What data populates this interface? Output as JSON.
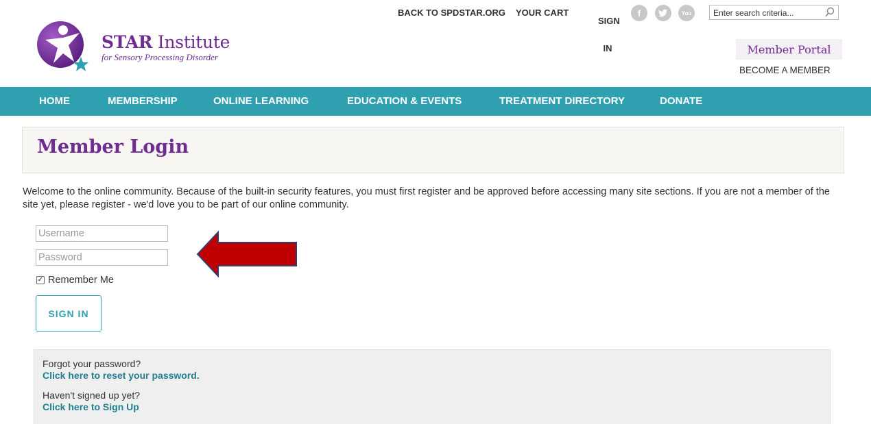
{
  "brand": {
    "name_bold": "STAR",
    "name_rest": "Institute",
    "tagline": "for Sensory Processing Disorder"
  },
  "toplinks": {
    "back": "BACK TO SPDSTAR.ORG",
    "cart": "YOUR CART",
    "signin": "SIGN IN"
  },
  "social": {
    "facebook": "f",
    "twitter": "t",
    "youtube": "You"
  },
  "search": {
    "placeholder": "Enter search criteria..."
  },
  "account": {
    "portal": "Member Portal",
    "become": "BECOME A MEMBER"
  },
  "nav": {
    "items": [
      "HOME",
      "MEMBERSHIP",
      "ONLINE LEARNING",
      "EDUCATION & EVENTS",
      "TREATMENT DIRECTORY",
      "DONATE"
    ]
  },
  "page": {
    "title": "Member Login",
    "intro": "Welcome to the online community. Because of the built-in security features, you must first register and be approved before accessing many site sections. If you are not a member of the site yet, please register - we'd love you to be part of our online community."
  },
  "form": {
    "username_placeholder": "Username",
    "password_placeholder": "Password",
    "remember_label": "Remember Me",
    "remember_checked": true,
    "submit_label": "SIGN IN"
  },
  "help": {
    "forgot_q": "Forgot your password?",
    "forgot_link": "Click here to reset your password.",
    "signup_q": "Haven't signed up yet?",
    "signup_link": "Click here to Sign Up"
  },
  "colors": {
    "brand_purple": "#6f2c91",
    "nav_teal": "#2ea0b0",
    "arrow_red": "#c00000",
    "arrow_outline": "#2f3f73"
  }
}
